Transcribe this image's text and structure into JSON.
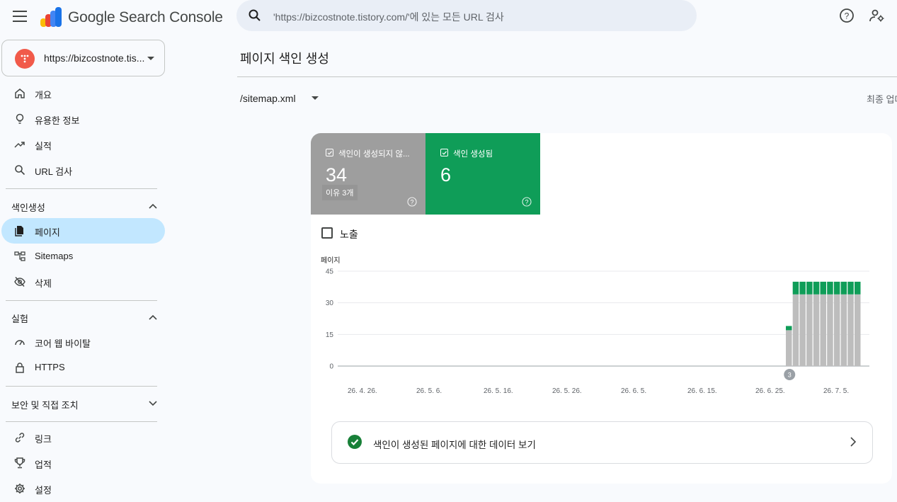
{
  "app": {
    "brand": "Google Search Console",
    "search_placeholder": "'https://bizcostnote.tistory.com/'에 있는 모든 URL 검사"
  },
  "property": {
    "label": "https://bizcostnote.tis..."
  },
  "sidebar": {
    "items_top": [
      {
        "label": "개요",
        "icon": "home-icon"
      },
      {
        "label": "유용한 정보",
        "icon": "lightbulb-icon"
      },
      {
        "label": "실적",
        "icon": "trending-up-icon"
      },
      {
        "label": "URL 검사",
        "icon": "search-icon"
      }
    ],
    "section_index": "색인생성",
    "items_index": [
      {
        "label": "페이지",
        "icon": "page-icon",
        "active": true
      },
      {
        "label": "Sitemaps",
        "icon": "sitemap-icon"
      },
      {
        "label": "삭제",
        "icon": "eye-off-icon"
      }
    ],
    "section_exp": "실험",
    "items_exp": [
      {
        "label": "코어 웹 바이탈",
        "icon": "gauge-icon"
      },
      {
        "label": "HTTPS",
        "icon": "lock-icon"
      }
    ],
    "section_security": "보안 및 직접 조치",
    "items_bottom": [
      {
        "label": "링크",
        "icon": "link-icon"
      },
      {
        "label": "업적",
        "icon": "trophy-icon"
      },
      {
        "label": "설정",
        "icon": "gear-icon"
      }
    ]
  },
  "main": {
    "title": "페이지 색인 생성",
    "sitemap": "/sitemap.xml",
    "last_update": "최종 업데",
    "tiles": {
      "not_indexed": {
        "label": "색인이 생성되지 않...",
        "value": "34",
        "reason": "이유 3개"
      },
      "indexed": {
        "label": "색인 생성됨",
        "value": "6"
      }
    },
    "impressions_label": "노출",
    "bottom_link": "색인이 생성된 페이지에 대한 데이터 보기"
  },
  "colors": {
    "not_indexed": "#9e9e9e",
    "indexed": "#0f9d58",
    "accent": "#c2e7ff"
  },
  "chart_data": {
    "type": "bar",
    "stacked": true,
    "ylabel": "페이지",
    "ylim": [
      0,
      45
    ],
    "yticks": [
      0,
      15,
      30,
      45
    ],
    "xtick_labels": [
      "26. 4. 26.",
      "26. 5. 6.",
      "26. 5. 16.",
      "26. 5. 26.",
      "26. 6. 5.",
      "26. 6. 15.",
      "26. 6. 25.",
      "26. 7. 5."
    ],
    "series": [
      {
        "values": [
          17,
          34,
          34,
          34,
          34,
          34,
          34,
          34,
          34,
          34,
          34
        ],
        "color": "#bdbdbd"
      },
      {
        "values": [
          2,
          6,
          6,
          6,
          6,
          6,
          6,
          6,
          6,
          6,
          6
        ],
        "color": "#0f9d58"
      }
    ],
    "annotation": "3"
  }
}
